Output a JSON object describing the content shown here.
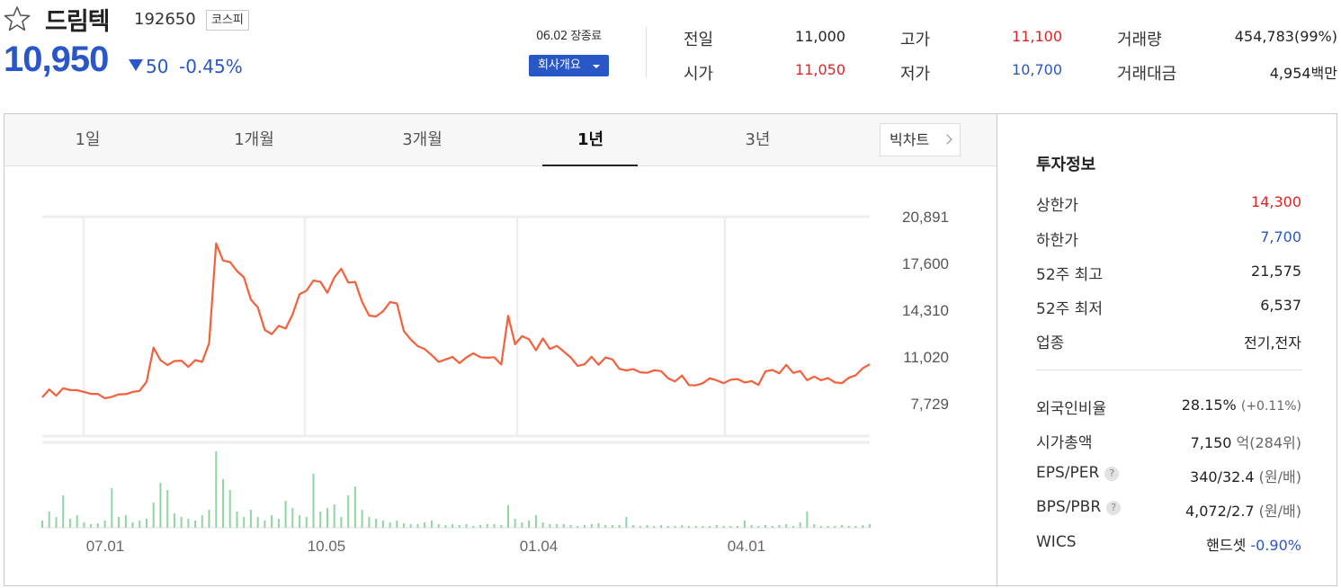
{
  "stock": {
    "name": "드림텍",
    "code": "192650",
    "market": "코스피",
    "price": "10,950",
    "change_abs": "50",
    "change_pct": "-0.45%",
    "session_time": "06.02 장종료",
    "company_button": "회사개요"
  },
  "quote": {
    "prev_close_label": "전일",
    "prev_close": "11,000",
    "open_label": "시가",
    "open": "11,050",
    "high_label": "고가",
    "high": "11,100",
    "low_label": "저가",
    "low": "10,700",
    "volume_label": "거래량",
    "volume": "454,783(99%)",
    "amount_label": "거래대금",
    "amount": "4,954백만"
  },
  "colors": {
    "up": "#e12323",
    "down": "#2a57c7",
    "line": "#f5603c",
    "volume": "#8dd6a1"
  },
  "tabs": [
    "1일",
    "1개월",
    "3개월",
    "1년",
    "3년"
  ],
  "active_tab": "1년",
  "bigchart_label": "빅차트",
  "chart_data": {
    "type": "line",
    "period": "1년",
    "yticks": [
      "20,891",
      "17,600",
      "14,310",
      "11,020",
      "7,729"
    ],
    "ytick_values": [
      20891,
      17600,
      14310,
      11020,
      7729
    ],
    "xticks": [
      "07.01",
      "10.05",
      "01.04",
      "04.01"
    ],
    "ylim": [
      7729,
      20891
    ],
    "grid": true,
    "price_series": [
      8180,
      8730,
      8290,
      8820,
      8690,
      8680,
      8560,
      8420,
      8420,
      8110,
      8210,
      8390,
      8400,
      8560,
      8630,
      9270,
      11680,
      10790,
      10450,
      10730,
      10760,
      10320,
      10800,
      10670,
      11980,
      19010,
      17800,
      17700,
      17060,
      16620,
      15060,
      14500,
      12920,
      12620,
      13210,
      13020,
      14020,
      15440,
      15680,
      16400,
      16310,
      15530,
      16610,
      17230,
      16250,
      16300,
      14890,
      13930,
      13870,
      14230,
      14880,
      14790,
      12840,
      12240,
      11780,
      11570,
      11150,
      10670,
      10840,
      11020,
      10580,
      10990,
      11280,
      11000,
      10960,
      11000,
      10490,
      13920,
      11910,
      12480,
      12260,
      11490,
      12320,
      11580,
      11800,
      11400,
      10980,
      10380,
      10510,
      11030,
      10460,
      10980,
      10850,
      10180,
      10070,
      10160,
      9940,
      9900,
      10080,
      10020,
      9520,
      9300,
      9710,
      9040,
      9020,
      9170,
      9520,
      9370,
      9170,
      9420,
      9460,
      9220,
      9320,
      9050,
      10000,
      10100,
      9860,
      10460,
      9890,
      10030,
      9380,
      9640,
      9380,
      9540,
      9230,
      9180,
      9560,
      9730,
      10230,
      10500
    ]
  },
  "volume_bars": [
    8,
    18,
    12,
    36,
    10,
    14,
    6,
    4,
    5,
    8,
    44,
    12,
    14,
    6,
    8,
    10,
    28,
    50,
    42,
    16,
    12,
    10,
    8,
    14,
    20,
    85,
    54,
    42,
    18,
    12,
    20,
    12,
    8,
    14,
    10,
    30,
    22,
    14,
    12,
    60,
    18,
    22,
    26,
    12,
    36,
    46,
    20,
    12,
    10,
    8,
    6,
    8,
    5,
    4,
    4,
    6,
    8,
    4,
    3,
    4,
    3,
    4,
    2,
    3,
    4,
    4,
    3,
    25,
    10,
    6,
    8,
    14,
    6,
    4,
    4,
    4,
    3,
    2,
    3,
    4,
    5,
    3,
    3,
    3,
    12,
    3,
    2,
    3,
    2,
    3,
    2,
    2,
    3,
    2,
    2,
    2,
    2,
    3,
    2,
    2,
    2,
    8,
    3,
    2,
    3,
    2,
    3,
    4,
    2,
    6,
    18,
    4,
    2,
    2,
    2,
    3,
    2,
    2,
    3,
    4
  ],
  "invest": {
    "title": "투자정보",
    "upper_limit_label": "상한가",
    "upper_limit": "14,300",
    "lower_limit_label": "하한가",
    "lower_limit": "7,700",
    "high52_label": "52주 최고",
    "high52": "21,575",
    "low52_label": "52주 최저",
    "low52": "6,537",
    "sector_label": "업종",
    "sector": "전기,전자",
    "foreign_label": "외국인비율",
    "foreign": "28.15%",
    "foreign_change": "(+0.11%)",
    "mcap_label": "시가총액",
    "mcap": "7,150",
    "mcap_unit": "억(284위)",
    "eps_label": "EPS/PER",
    "eps": "340/32.4",
    "eps_unit": "(원/배)",
    "bps_label": "BPS/PBR",
    "bps": "4,072/2.7",
    "bps_unit": "(원/배)",
    "wics_label": "WICS",
    "wics": "핸드셋",
    "wics_change": "-0.90%",
    "help_glyph": "?"
  }
}
